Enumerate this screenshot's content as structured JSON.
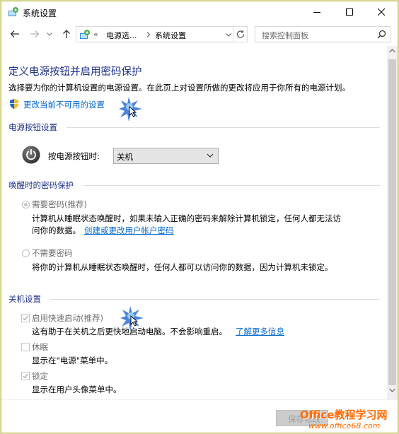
{
  "window": {
    "title": "系统设置",
    "controls": {
      "minimize": "minimize",
      "maximize": "maximize",
      "close": "close"
    }
  },
  "address_bar": {
    "prefix": "«",
    "crumbs": [
      "电源选...",
      "系统设置"
    ],
    "search_placeholder": "搜索控制面板"
  },
  "page": {
    "title": "定义电源按钮并启用密码保护",
    "description": "选择要为你的计算机设置的电源设置。在此页上对设置所做的更改将应用于你所有的电源计划。",
    "change_unavailable_link": "更改当前不可用的设置"
  },
  "power_buttons": {
    "heading": "电源按钮设置",
    "label": "按电源按钮时:",
    "selected": "关机"
  },
  "wake_password": {
    "heading": "唤醒时的密码保护",
    "options": [
      {
        "label": "需要密码(推荐)",
        "selected": true,
        "desc_line1": "计算机从睡眠状态唤醒时，如果未输入正确的密码来解除计算机锁定，任何人都无法访",
        "desc_line2": "问你的数据。",
        "link": "创建或更改用户帐户密码"
      },
      {
        "label": "不需要密码",
        "selected": false,
        "desc_line1": "将你的计算机从睡眠状态唤醒时，任何人都可以访问你的数据，因为计算机未锁定。"
      }
    ]
  },
  "shutdown": {
    "heading": "关机设置",
    "items": [
      {
        "label": "启用快速启动(推荐)",
        "checked": true,
        "desc": "这有助于在关机之后更快地启动电脑。不会影响重启。",
        "link": "了解更多信息"
      },
      {
        "label": "休眠",
        "checked": false,
        "desc": "显示在\"电源\"菜单中。"
      },
      {
        "label": "锁定",
        "checked": true,
        "desc": "显示在用户头像菜单中。"
      }
    ]
  },
  "footer": {
    "save_label": "保存修改"
  },
  "watermark": {
    "brand": "Office教程学习网",
    "url": "www.office68.com"
  },
  "colors": {
    "heading": "#1e3287",
    "link": "#0066cc",
    "frame": "#dcdc9a"
  }
}
